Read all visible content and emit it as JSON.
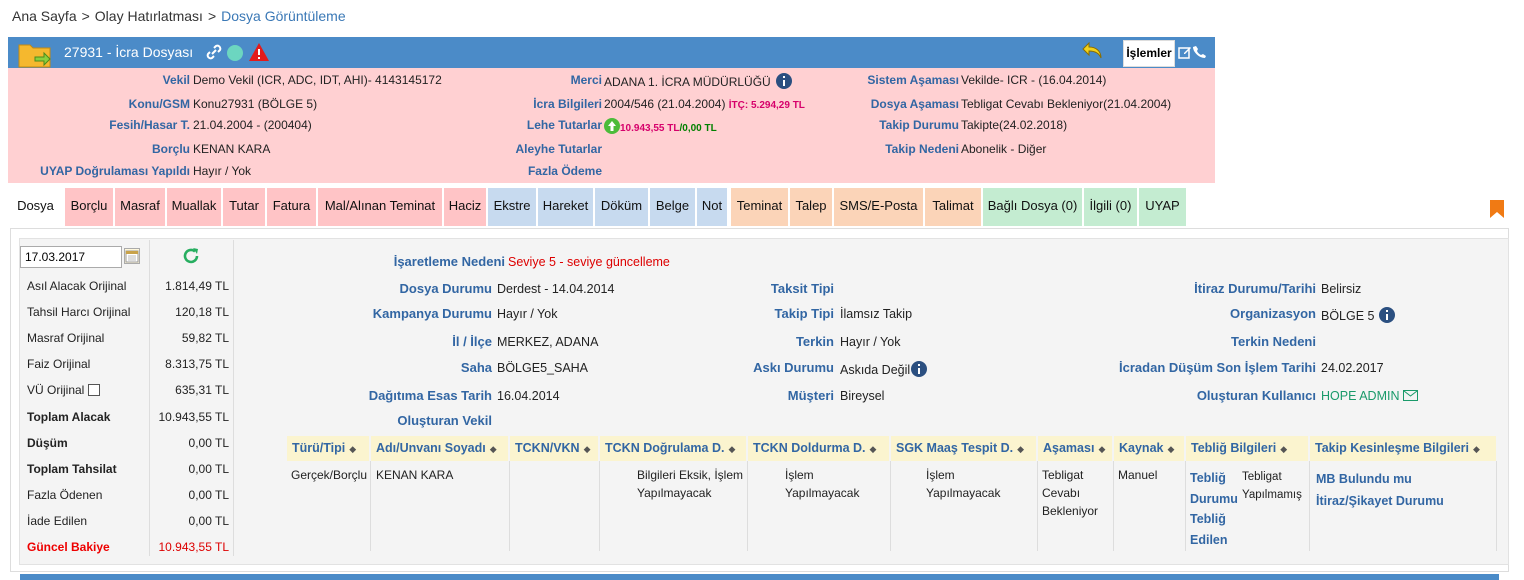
{
  "breadcrumb": {
    "home": "Ana Sayfa",
    "mid": "Olay Hatırlatması",
    "current": "Dosya Görüntüleme",
    "sep": ">"
  },
  "header": {
    "title": "27931 - İcra Dosyası",
    "actions_label": "İşlemler",
    "color": "#4b8bc8"
  },
  "info": {
    "vekil_l": "Vekil",
    "vekil_v": "Demo Vekil  (ICR, ADC, IDT, AHI)- 4143145172",
    "konu_l": "Konu/GSM",
    "konu_v": "Konu27931 (BÖLGE 5)",
    "fesih_l": "Fesih/Hasar T.",
    "fesih_v": "21.04.2004 - (200404)",
    "borclu_l": "Borçlu",
    "borclu_v": "KENAN KARA",
    "uyap_l": "UYAP Doğrulaması Yapıldı",
    "uyap_v": "Hayır / Yok",
    "merci_l": "Merci",
    "merci_v": "ADANA 1. İCRA MÜDÜRLÜĞÜ",
    "icra_l": "İcra Bilgileri",
    "icra_v": "2004/546 (21.04.2004)",
    "itc_v": "İTÇ:  5.294,29 TL",
    "lehe_l": "Lehe Tutarlar",
    "lehe_v1": "10.943,55 TL",
    "lehe_sep": "/",
    "lehe_v2": "0,00 TL",
    "aleyhe_l": "Aleyhe Tutarlar",
    "fazla_l": "Fazla Ödeme",
    "sistem_l": "Sistem Aşaması",
    "sistem_v": "Vekilde- ICR - (16.04.2014)",
    "dosya_l": "Dosya Aşaması",
    "dosya_v": "Tebligat Cevabı Bekleniyor(21.04.2004)",
    "takip_l": "Takip Durumu",
    "takip_v": "Takipte(24.02.2018)",
    "neden_l": "Takip Nedeni",
    "neden_v": "Abonelik - Diğer"
  },
  "tabs": [
    "Dosya",
    "Borçlu",
    "Masraf",
    "Muallak",
    "Tutar",
    "Fatura",
    "Mal/Alınan Teminat",
    "Haciz",
    "Ekstre",
    "Hareket",
    "Döküm",
    "Belge",
    "Not",
    "Teminat",
    "Talep",
    "SMS/E-Posta",
    "Talimat",
    "Bağlı Dosya (0)",
    "İlgili (0)",
    "UYAP"
  ],
  "summary": {
    "date": "17.03.2017",
    "rows": [
      {
        "label": "Asıl Alacak Orijinal",
        "value": "1.814,49 TL"
      },
      {
        "label": "Tahsil Harcı Orijinal",
        "value": "120,18 TL"
      },
      {
        "label": "Masraf Orijinal",
        "value": "59,82 TL"
      },
      {
        "label": "Faiz Orijinal",
        "value": "8.313,75 TL"
      },
      {
        "label": "VÜ Orijinal",
        "value": "635,31 TL"
      },
      {
        "label": "Toplam Alacak",
        "value": "10.943,55 TL"
      },
      {
        "label": "Düşüm",
        "value": "0,00 TL"
      },
      {
        "label": "Toplam Tahsilat",
        "value": "0,00 TL"
      },
      {
        "label": "Fazla Ödenen",
        "value": "0,00 TL"
      },
      {
        "label": "İade Edilen",
        "value": "0,00 TL"
      },
      {
        "label": "Güncel Bakiye",
        "value": "10.943,55 TL"
      }
    ]
  },
  "details": {
    "isaret_l": "İşaretleme Nedeni",
    "isaret_v": "Seviye 5 - seviye güncelleme",
    "durum_l": "Dosya Durumu",
    "durum_v": "Derdest - 14.04.2014",
    "kampanya_l": "Kampanya Durumu",
    "kampanya_v": "Hayır / Yok",
    "il_l": "İl / İlçe",
    "il_v": "MERKEZ, ADANA",
    "saha_l": "Saha",
    "saha_v": "BÖLGE5_SAHA",
    "dagitim_l": "Dağıtıma Esas Tarih",
    "dagitim_v": "16.04.2014",
    "olusturan_vekil_l": "Oluşturan Vekil",
    "taksit_l": "Taksit Tipi",
    "takiptipi_l": "Takip Tipi",
    "takiptipi_v": "İlamsız Takip",
    "terkin_l": "Terkin",
    "terkin_v": "Hayır / Yok",
    "aski_l": "Askı Durumu",
    "aski_v": "Askıda Değil",
    "musteri_l": "Müşteri",
    "musteri_v": "Bireysel",
    "itiraz_l": "İtiraz Durumu/Tarihi",
    "itiraz_v": "Belirsiz",
    "org_l": "Organizasyon",
    "org_v": "BÖLGE 5",
    "terkinneden_l": "Terkin Nedeni",
    "dusum_l": "İcradan Düşüm Son İşlem Tarihi",
    "dusum_v": "24.02.2017",
    "kullanici_l": "Oluşturan Kullanıcı",
    "kullanici_v": "HOPE ADMIN"
  },
  "table": {
    "headers": [
      "Türü/Tipi",
      "Adı/Unvanı Soyadı",
      "TCKN/VKN",
      "TCKN Doğrulama D.",
      "TCKN Doldurma D.",
      "SGK Maaş Tespit D.",
      "Aşaması",
      "Kaynak",
      "Tebliğ Bilgileri",
      "Takip Kesinleşme Bilgileri"
    ],
    "row": {
      "tur": "Gerçek/Borçlu",
      "ad": "KENAN KARA",
      "dogrulama": "Bilgileri Eksik, İşlem Yapılmayacak",
      "doldurma": "İşlem Yapılmayacak",
      "sgk": "İşlem Yapılmayacak",
      "asama": "Tebligat Cevabı Bekleniyor",
      "kaynak": "Manuel",
      "teblig_durumu_l": "Tebliğ Durumu",
      "teblig_durumu_v": "Tebligat Yapılmamış",
      "teblig_edilen_l": "Tebliğ Edilen",
      "mb": "MB Bulundu mu",
      "itiraz": "İtiraz/Şikayet Durumu"
    }
  }
}
